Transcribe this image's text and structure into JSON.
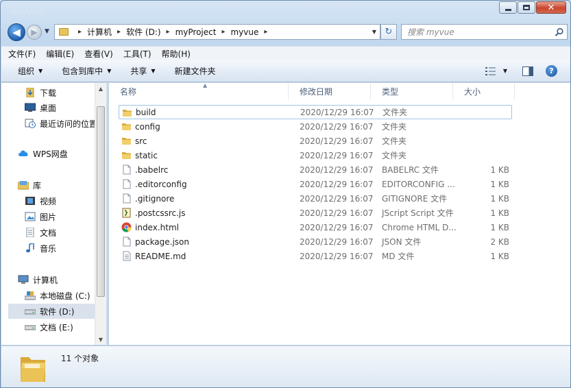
{
  "window": {
    "title": "myvue"
  },
  "caption": {
    "minimize": "—",
    "maximize": "□",
    "close": "✕"
  },
  "nav": {
    "back_glyph": "◀",
    "forward_glyph": "▶",
    "history_glyph": "▼",
    "breadcrumbs": [
      {
        "label": "计算机"
      },
      {
        "label": "软件 (D:)"
      },
      {
        "label": "myProject"
      },
      {
        "label": "myvue"
      }
    ],
    "separator": "▸",
    "dropdown_glyph": "▼",
    "refresh_glyph": "↻",
    "search_placeholder": "搜索 myvue"
  },
  "menu": {
    "items": [
      "文件(F)",
      "编辑(E)",
      "查看(V)",
      "工具(T)",
      "帮助(H)"
    ]
  },
  "commands": {
    "items": [
      {
        "label": "组织",
        "has_caret": true
      },
      {
        "label": "包含到库中",
        "has_caret": true
      },
      {
        "label": "共享",
        "has_caret": true
      },
      {
        "label": "新建文件夹",
        "has_caret": false
      }
    ],
    "caret": "▼",
    "help_glyph": "?"
  },
  "navpane": {
    "items": [
      {
        "label": "下载",
        "icon": "downloads-icon"
      },
      {
        "label": "桌面",
        "icon": "desktop-icon"
      },
      {
        "label": "最近访问的位置",
        "icon": "recent-places-icon"
      },
      {
        "label": "WPS网盘",
        "icon": "cloud-icon"
      },
      {
        "label": "库",
        "icon": "library-icon"
      },
      {
        "label": "视频",
        "icon": "video-icon"
      },
      {
        "label": "图片",
        "icon": "picture-icon"
      },
      {
        "label": "文档",
        "icon": "document-icon"
      },
      {
        "label": "音乐",
        "icon": "music-icon"
      },
      {
        "label": "计算机",
        "icon": "computer-icon"
      },
      {
        "label": "本地磁盘 (C:)",
        "icon": "system-drive-icon"
      },
      {
        "label": "软件 (D:)",
        "icon": "drive-icon",
        "selected": true
      },
      {
        "label": "文档 (E:)",
        "icon": "drive-icon"
      }
    ],
    "scroll_up": "▲",
    "scroll_down": "▼"
  },
  "filelist": {
    "columns": [
      "名称",
      "修改日期",
      "类型",
      "大小"
    ],
    "sort_glyph": "▲",
    "rows": [
      {
        "name": "build",
        "date": "2020/12/29 16:07",
        "type": "文件夹",
        "size": "",
        "icon": "folder-icon"
      },
      {
        "name": "config",
        "date": "2020/12/29 16:07",
        "type": "文件夹",
        "size": "",
        "icon": "folder-icon"
      },
      {
        "name": "src",
        "date": "2020/12/29 16:07",
        "type": "文件夹",
        "size": "",
        "icon": "folder-icon"
      },
      {
        "name": "static",
        "date": "2020/12/29 16:07",
        "type": "文件夹",
        "size": "",
        "icon": "folder-icon"
      },
      {
        "name": ".babelrc",
        "date": "2020/12/29 16:07",
        "type": "BABELRC 文件",
        "size": "1 KB",
        "icon": "file-icon"
      },
      {
        "name": ".editorconfig",
        "date": "2020/12/29 16:07",
        "type": "EDITORCONFIG ...",
        "size": "1 KB",
        "icon": "file-icon"
      },
      {
        "name": ".gitignore",
        "date": "2020/12/29 16:07",
        "type": "GITIGNORE 文件",
        "size": "1 KB",
        "icon": "file-icon"
      },
      {
        "name": ".postcssrc.js",
        "date": "2020/12/29 16:07",
        "type": "JScript Script 文件",
        "size": "1 KB",
        "icon": "script-icon"
      },
      {
        "name": "index.html",
        "date": "2020/12/29 16:07",
        "type": "Chrome HTML D...",
        "size": "1 KB",
        "icon": "chrome-icon"
      },
      {
        "name": "package.json",
        "date": "2020/12/29 16:07",
        "type": "JSON 文件",
        "size": "2 KB",
        "icon": "file-icon"
      },
      {
        "name": "README.md",
        "date": "2020/12/29 16:07",
        "type": "MD 文件",
        "size": "1 KB",
        "icon": "text-file-icon"
      }
    ]
  },
  "details": {
    "count": "11 个对象"
  },
  "colors": {
    "folder": "#e8c45a",
    "selection": "#d9e1ec",
    "hover_border": "#9ec3e6",
    "accent": "#1f5fae"
  }
}
